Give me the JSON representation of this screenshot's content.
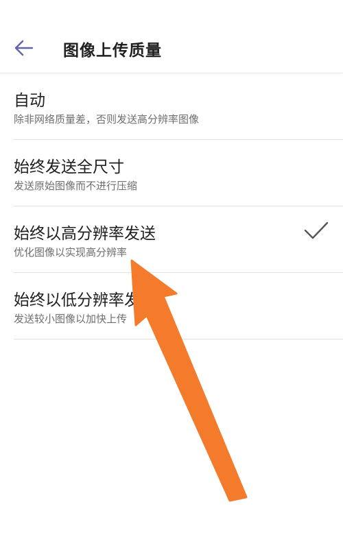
{
  "header": {
    "title": "图像上传质量",
    "back_icon": "back-arrow-icon"
  },
  "options": [
    {
      "title": "自动",
      "desc": "除非网络质量差，否则发送高分辨率图像",
      "selected": false
    },
    {
      "title": "始终发送全尺寸",
      "desc": "发送原始图像而不进行压缩",
      "selected": false
    },
    {
      "title": "始终以高分辨率发送",
      "desc": "优化图像以实现高分辨率",
      "selected": true
    },
    {
      "title": "始终以低分辨率发送",
      "desc": "发送较小图像以加快上传",
      "selected": false
    }
  ],
  "colors": {
    "accent": "#6264A7",
    "annotation_arrow": "#F47A2C",
    "divider": "#E3E3E3",
    "check": "#555555"
  }
}
